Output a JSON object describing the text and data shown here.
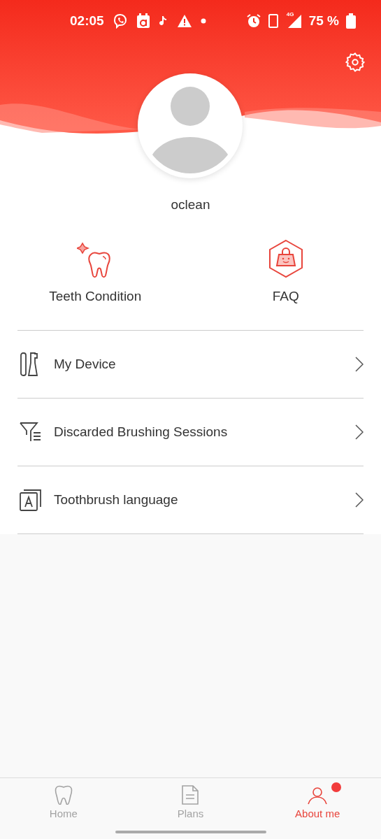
{
  "status_bar": {
    "time": "02:05",
    "network": "4G",
    "battery": "75 %"
  },
  "profile": {
    "name": "oclean"
  },
  "shortcuts": [
    {
      "label": "Teeth Condition",
      "kind": "tooth"
    },
    {
      "label": "FAQ",
      "kind": "bag"
    }
  ],
  "menu": [
    {
      "label": "My Device",
      "kind": "device"
    },
    {
      "label": "Discarded Brushing Sessions",
      "kind": "filter"
    },
    {
      "label": "Toothbrush language",
      "kind": "language"
    }
  ],
  "nav": [
    {
      "label": "Home",
      "kind": "home",
      "selected": false,
      "badge": false
    },
    {
      "label": "Plans",
      "kind": "plans",
      "selected": false,
      "badge": false
    },
    {
      "label": "About me",
      "kind": "me",
      "selected": true,
      "badge": true
    }
  ]
}
